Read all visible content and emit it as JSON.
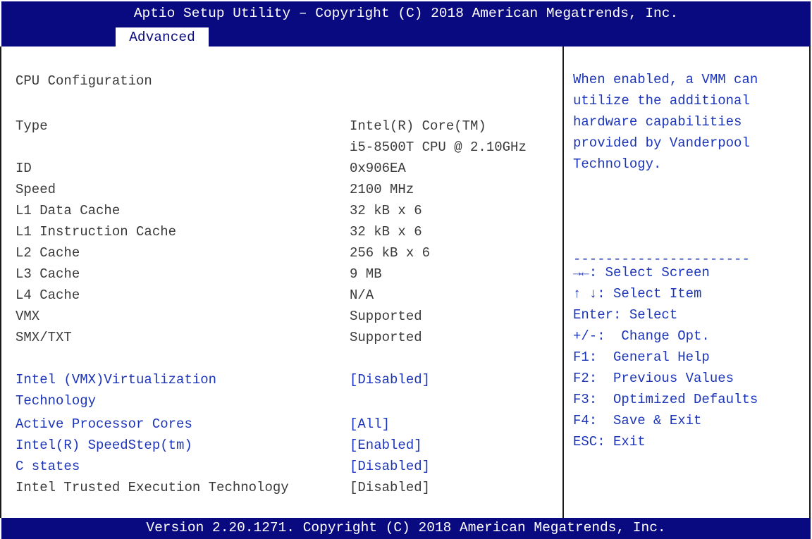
{
  "header": {
    "title": "Aptio Setup Utility – Copyright (C) 2018 American Megatrends, Inc.",
    "active_tab": "Advanced"
  },
  "main": {
    "section_title": "CPU Configuration",
    "info": [
      {
        "label": "Type",
        "value": "Intel(R) Core(TM)",
        "value2": "i5-8500T CPU @ 2.10GHz"
      },
      {
        "label": "ID",
        "value": "0x906EA"
      },
      {
        "label": "Speed",
        "value": "2100 MHz"
      },
      {
        "label": "L1 Data Cache",
        "value": "32 kB x 6"
      },
      {
        "label": "L1 Instruction Cache",
        "value": "32 kB x 6"
      },
      {
        "label": "L2 Cache",
        "value": "256 kB x 6"
      },
      {
        "label": "L3 Cache",
        "value": "9 MB"
      },
      {
        "label": "L4 Cache",
        "value": "N/A"
      },
      {
        "label": "VMX",
        "value": "Supported"
      },
      {
        "label": "SMX/TXT",
        "value": "Supported"
      }
    ],
    "options": [
      {
        "label": "Intel (VMX)Virtualization",
        "label2": "Technology",
        "value": "[Disabled]"
      },
      {
        "label": "Active Processor Cores",
        "value": "[All]"
      },
      {
        "label": "Intel(R) SpeedStep(tm)",
        "value": "[Enabled]"
      },
      {
        "label": "C states",
        "value": "[Disabled]"
      },
      {
        "label": "Intel Trusted Execution Technology",
        "value": "[Disabled]"
      }
    ]
  },
  "help_panel": {
    "description": "When enabled, a VMM can utilize the additional hardware capabilities provided by Vanderpool Technology.",
    "separator": "----------------------",
    "keys": [
      "→←: Select Screen",
      "↑ ↓: Select Item",
      "Enter: Select",
      "+/-:  Change Opt.",
      "F1:  General Help",
      "F2:  Previous Values",
      "F3:  Optimized Defaults",
      "F4:  Save & Exit",
      "ESC: Exit"
    ]
  },
  "footer": {
    "version": "Version 2.20.1271. Copyright (C) 2018 American Megatrends, Inc."
  },
  "colors": {
    "bar_background": "#0a0a80",
    "selectable_text": "#1c35b8",
    "static_text": "#3a3a3a"
  }
}
